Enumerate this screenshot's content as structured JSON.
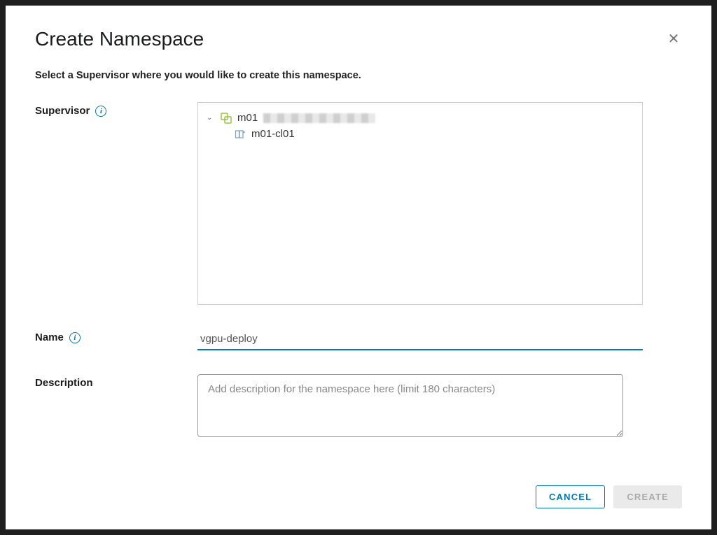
{
  "modal": {
    "title": "Create Namespace",
    "instruction": "Select a Supervisor where you would like to create this namespace."
  },
  "form": {
    "supervisor_label": "Supervisor",
    "name_label": "Name",
    "description_label": "Description",
    "name_value": "vgpu-deploy",
    "description_value": "",
    "description_placeholder": "Add description for the namespace here (limit 180 characters)"
  },
  "tree": {
    "root_label": "m01",
    "child_label": "m01-cl01"
  },
  "footer": {
    "cancel_label": "CANCEL",
    "create_label": "CREATE"
  },
  "icons": {
    "info": "i",
    "chevron_down": "⌄",
    "close": "✕"
  }
}
